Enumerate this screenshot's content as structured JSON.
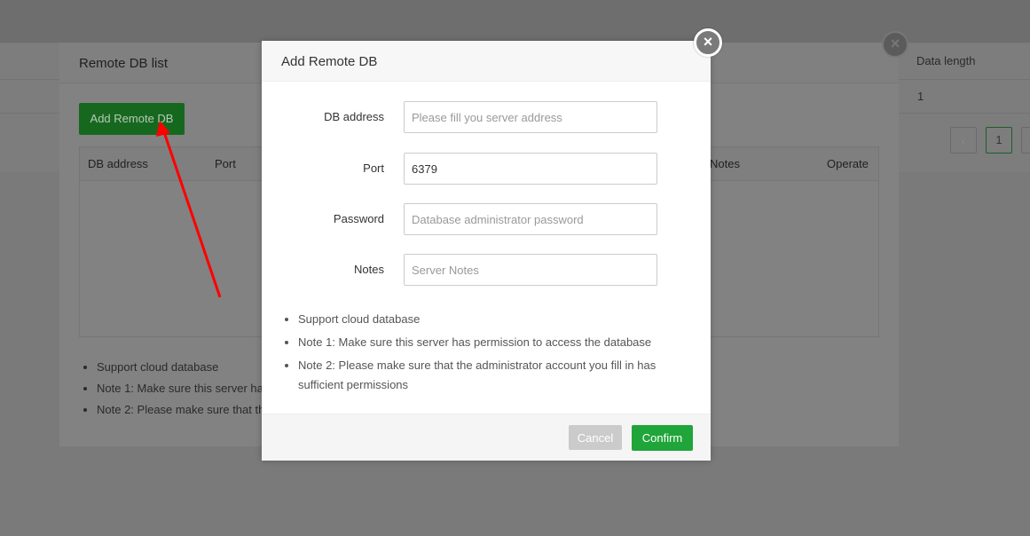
{
  "background": {
    "column_data_length": "Data length",
    "cell_value": "1",
    "pager_prev": "‹",
    "pager_page": "1"
  },
  "list_dialog": {
    "title": "Remote DB list",
    "add_button": "Add Remote DB",
    "columns": [
      "DB address",
      "Port",
      "Notes",
      "Operate"
    ],
    "notes": [
      "Support cloud database",
      "Note 1: Make sure this server ha",
      "Note 2: Please make sure that th"
    ],
    "close_icon": "×"
  },
  "add_dialog": {
    "title": "Add Remote DB",
    "close_icon": "×",
    "fields": [
      {
        "label": "DB address",
        "value": "",
        "placeholder": "Please fill you server address"
      },
      {
        "label": "Port",
        "value": "6379",
        "placeholder": ""
      },
      {
        "label": "Password",
        "value": "",
        "placeholder": "Database administrator password"
      },
      {
        "label": "Notes",
        "value": "",
        "placeholder": "Server Notes"
      }
    ],
    "notes": [
      "Support cloud database",
      "Note 1: Make sure this server has permission to access the database",
      "Note 2: Please make sure that the administrator account you fill in has sufficient permissions"
    ],
    "cancel_label": "Cancel",
    "confirm_label": "Confirm"
  },
  "colors": {
    "accent_green": "#20a53a",
    "annotation_arrow": "#ff0000"
  }
}
